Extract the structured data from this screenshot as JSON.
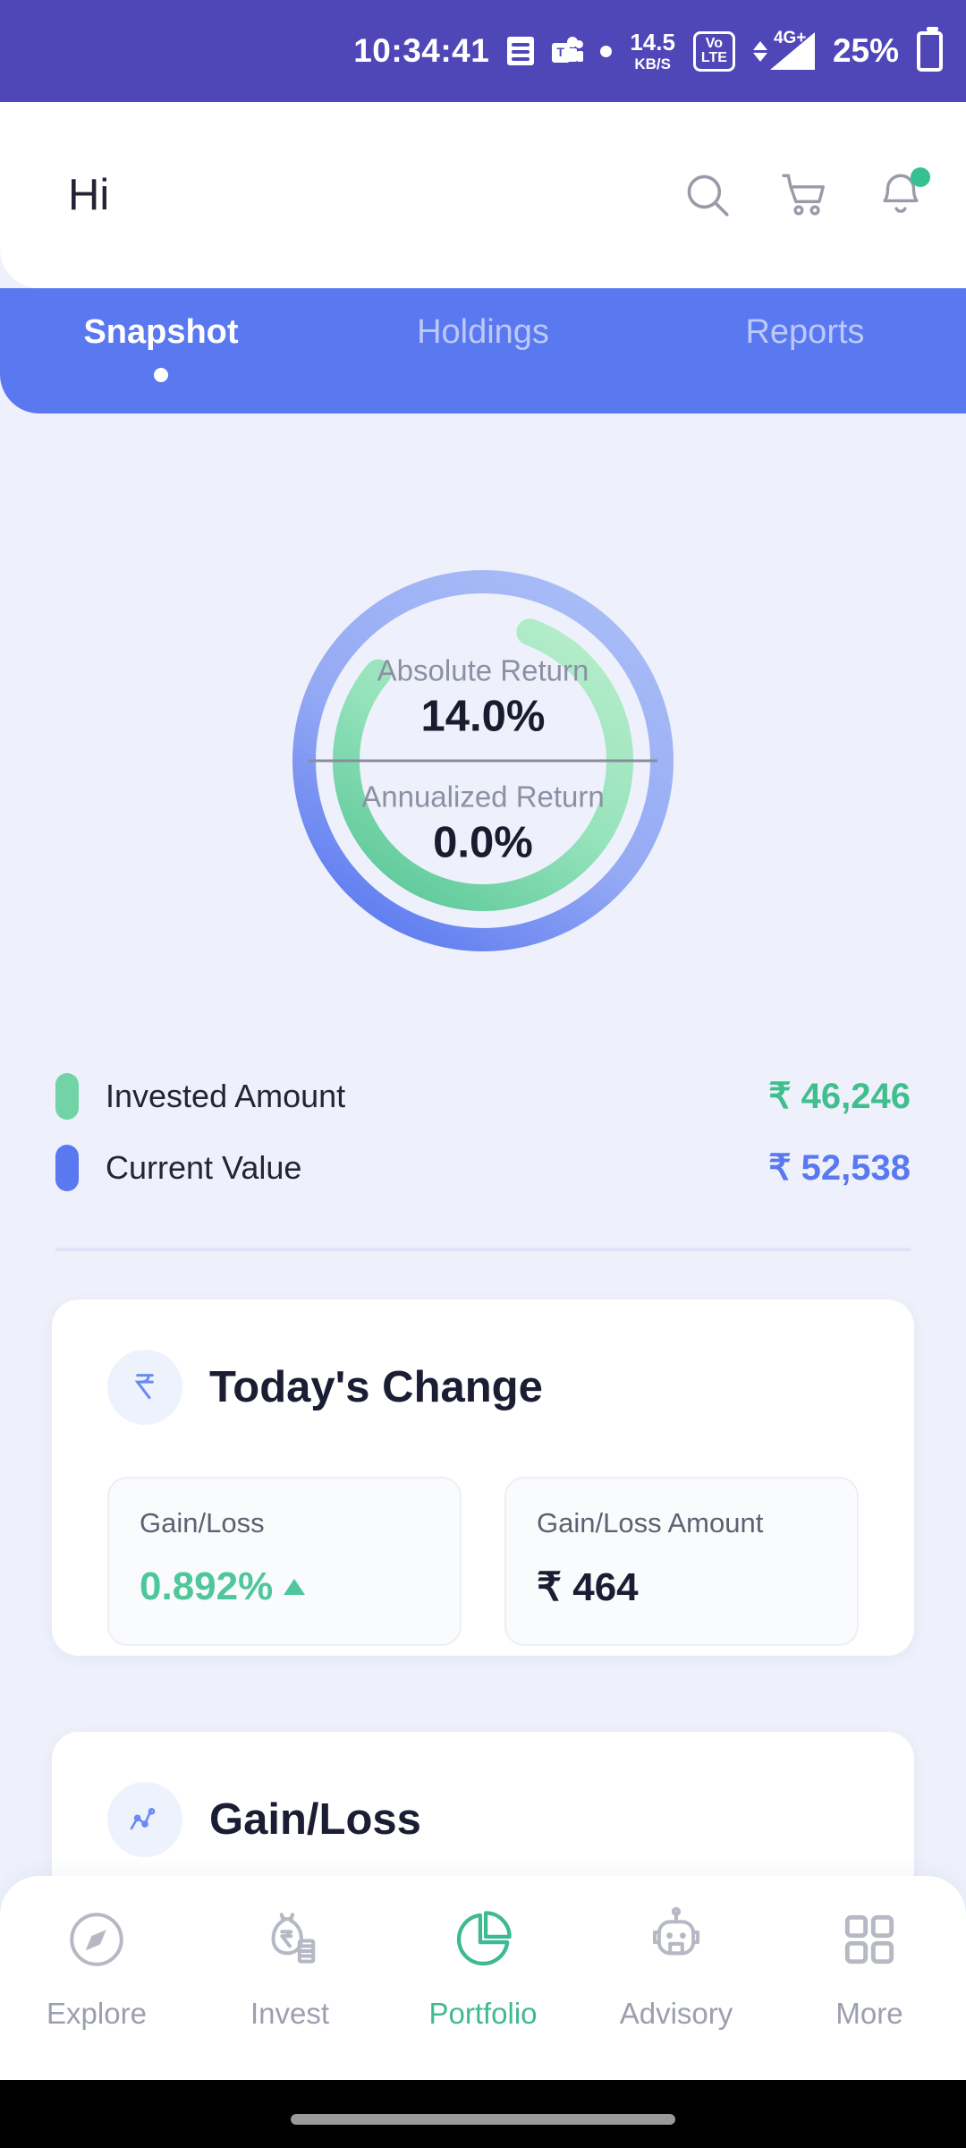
{
  "statusbar": {
    "time": "10:34:41",
    "network_speed_value": "14.5",
    "network_speed_unit": "KB/S",
    "volte_top": "Vo",
    "volte_bottom": "LTE",
    "network_type": "4G+",
    "battery_percent": "25%",
    "icons": [
      "document-icon",
      "teams-icon",
      "dot-icon",
      "volte-icon",
      "signal-icon",
      "battery-icon"
    ]
  },
  "header": {
    "greeting": "Hi",
    "icons": [
      "search-icon",
      "cart-icon",
      "notification-bell-icon"
    ],
    "notification_badge": true,
    "badge_color": "#35c191"
  },
  "tabs": {
    "items": [
      {
        "label": "Snapshot",
        "active": true
      },
      {
        "label": "Holdings",
        "active": false
      },
      {
        "label": "Reports",
        "active": false
      }
    ],
    "bar_color": "#5a78f0",
    "active_color": "#ffffff",
    "inactive_color": "#bcc9f8"
  },
  "chart_data": {
    "type": "pie",
    "title": "Portfolio Returns Donut",
    "center_metrics": [
      {
        "label": "Absolute Return",
        "value": "14.0%"
      },
      {
        "label": "Annualized Return",
        "value": "0.0%"
      }
    ],
    "rings": [
      {
        "name": "Current Value",
        "color": "#5a78f0",
        "amount": 52538,
        "sweep_degrees": 360,
        "start_degrees": 0,
        "radius": 200,
        "stroke": 26
      },
      {
        "name": "Invested Amount",
        "color": "#72d3a6",
        "amount": 46246,
        "sweep_degrees": 290,
        "start_degrees": 20,
        "radius": 153,
        "stroke": 30
      }
    ],
    "legend_position": "below"
  },
  "legend": {
    "rows": [
      {
        "name": "Invested Amount",
        "value": "₹ 46,246",
        "color": "#72d3a6"
      },
      {
        "name": "Current Value",
        "value": "₹ 52,538",
        "color": "#5a78f0"
      }
    ]
  },
  "todays_change": {
    "icon": "rupee-icon",
    "title": "Today's Change",
    "stats": [
      {
        "label": "Gain/Loss",
        "value": "0.892%",
        "direction": "up",
        "color": "#4ec79a"
      },
      {
        "label": "Gain/Loss Amount",
        "value": "₹ 464",
        "direction": "none",
        "color": "#1b1d33"
      }
    ]
  },
  "gain_loss_card": {
    "icon": "line-chart-icon",
    "title": "Gain/Loss"
  },
  "bottom_nav": {
    "items": [
      {
        "label": "Explore",
        "icon": "compass-icon",
        "active": false
      },
      {
        "label": "Invest",
        "icon": "money-bag-icon",
        "active": false
      },
      {
        "label": "Portfolio",
        "icon": "pie-chart-icon",
        "active": true
      },
      {
        "label": "Advisory",
        "icon": "robot-icon",
        "active": false
      },
      {
        "label": "More",
        "icon": "grid-icon",
        "active": false
      }
    ],
    "active_color": "#3fb993",
    "inactive_color": "#b6b9c4"
  }
}
